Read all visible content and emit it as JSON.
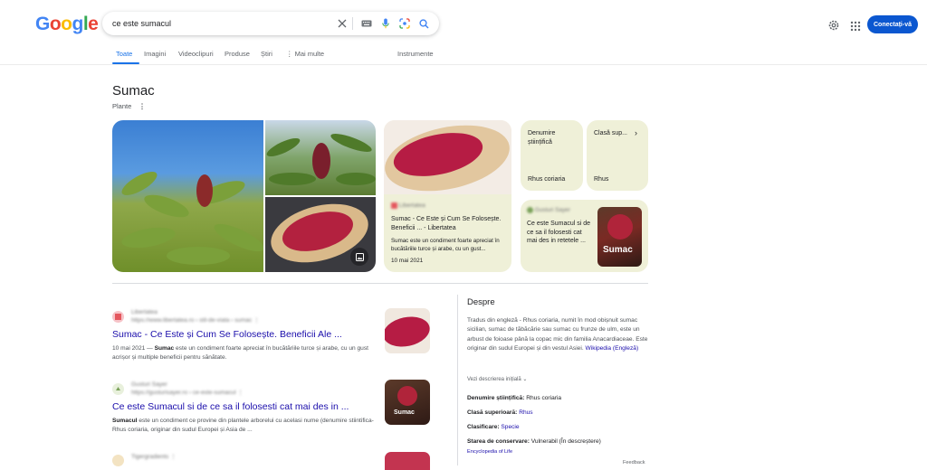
{
  "header": {
    "logo_text": "Google",
    "search": {
      "value": "ce este sumacul",
      "placeholder": ""
    },
    "signin_label": "Conectați-vă",
    "icons": [
      "clear-icon",
      "keyboard-icon",
      "mic-icon",
      "lens-icon",
      "search-icon",
      "settings-icon",
      "apps-icon"
    ]
  },
  "tabs": {
    "items": [
      "Toate",
      "Imagini",
      "Videoclipuri",
      "Produse",
      "Știri",
      "⋮ Mai multe"
    ],
    "tools": "Instrumente",
    "active": "Toate"
  },
  "knowledge": {
    "title": "Sumac",
    "subtitle": "Plante"
  },
  "cards": {
    "article": {
      "title": "Sumac - Ce Este și Cum Se Folosește. Beneficii ... - Libertatea",
      "snippet": "Sumac este un condiment foarte apreciat în bucătăriile turce și arabe, cu un gust...",
      "date": "10 mai 2021"
    },
    "fact1": {
      "label": "Denumire științifică",
      "value": "Rhus coriaria"
    },
    "fact2": {
      "label": "Clasă sup...",
      "value": "Rhus"
    },
    "article2": {
      "title": "Ce este Sumacul si de ce sa il folosesti cat mai des in retetele ...",
      "thumb_text": "Sumac"
    }
  },
  "results": [
    {
      "title": "Sumac - Ce Este și Cum Se Folosește. Beneficii Ale ...",
      "date": "10 mai 2021 — ",
      "bold": "Sumac",
      "snippet": " este un condiment foarte apreciat în bucătăriile turce și arabe, cu un gust acrișor și multiple beneficii pentru sănătate."
    },
    {
      "title": "Ce este Sumacul si de ce sa il folosesti cat mai des in ...",
      "bold": "Sumacul",
      "snippet": " este un condiment ce provine din plantele arborelui cu acelasi nume (denumire stiintifica- Rhus coriaria, originar din sudul Europei și Asia de ..."
    }
  ],
  "about": {
    "heading": "Despre",
    "text": "Tradus din engleză - Rhus coriaria, numit în mod obișnuit sumac sicilian, sumac de tăbăcărie sau sumac cu frunze de ulm, este un arbust de foioase până la copac mic din familia Anacardiaceae. Este originar din sudul Europei și din vestul Asiei.",
    "source": "Wikipedia (Engleză)",
    "original_link": "Vezi descrierea inițială",
    "facts": [
      {
        "label": "Denumire științifică:",
        "value": "Rhus coriaria",
        "link": false
      },
      {
        "label": "Clasă superioară:",
        "value": "Rhus",
        "link": true
      },
      {
        "label": "Clasificare:",
        "value": "Specie",
        "link": true
      },
      {
        "label": "Starea de conservare:",
        "value": "Vulnerabil (În descreștere)",
        "link": false
      }
    ],
    "source2": "Encyclopedia of Life",
    "feedback": "Feedback"
  },
  "colors": {
    "link": "#1a0dab",
    "accent": "#1a73e8",
    "button": "#0b57d0",
    "card_bg": "#eff0d8"
  }
}
